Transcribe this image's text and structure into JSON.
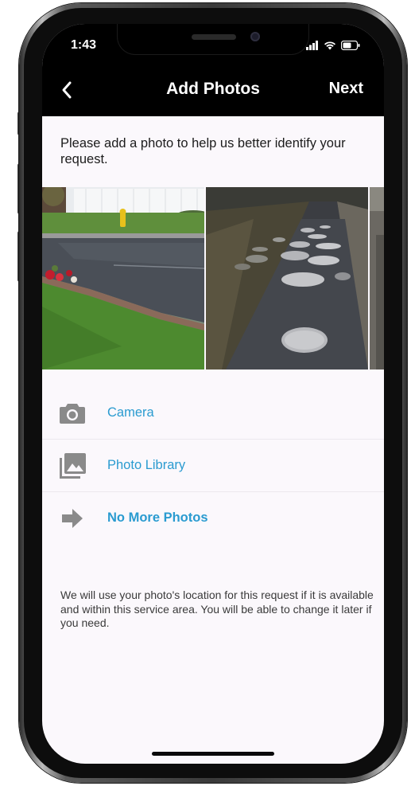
{
  "status_bar": {
    "time": "1:43"
  },
  "nav": {
    "title": "Add Photos",
    "next_label": "Next",
    "back_icon": "chevron-left-icon"
  },
  "intro_text": "Please add a photo to help us better identify your request.",
  "photos": [
    {
      "label": "photo-wet-street-curb"
    },
    {
      "label": "photo-potholed-road"
    },
    {
      "label": "photo-partial-third"
    }
  ],
  "options": [
    {
      "label": "Camera",
      "icon": "camera-icon",
      "bold": false
    },
    {
      "label": "Photo Library",
      "icon": "photo-library-icon",
      "bold": false
    },
    {
      "label": "No More Photos",
      "icon": "arrow-right-icon",
      "bold": true
    }
  ],
  "footnote": "We will use your photo's location for this request if it is available and within this service area.  You will be able to change it later if you need.",
  "colors": {
    "accent": "#2a9bd0",
    "nav_background": "#000000",
    "screen_background": "#fbf8fc",
    "icon_gray": "#8a8a8a"
  }
}
